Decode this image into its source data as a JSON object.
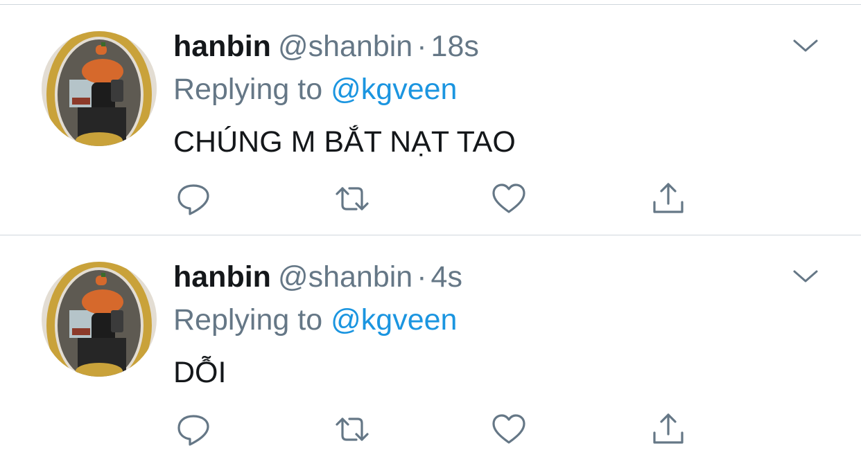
{
  "tweets": [
    {
      "display_name": "hanbin",
      "handle": "@shanbin",
      "separator": "·",
      "time": "18s",
      "replying_prefix": "Replying to",
      "replying_to": "@kgveen",
      "text": "CHÚNG M BẮT NẠT TAO"
    },
    {
      "display_name": "hanbin",
      "handle": "@shanbin",
      "separator": "·",
      "time": "4s",
      "replying_prefix": "Replying to",
      "replying_to": "@kgveen",
      "text": "DỖI"
    }
  ],
  "icons": {
    "menu": "chevron-down-icon",
    "reply": "reply-icon",
    "retweet": "retweet-icon",
    "like": "heart-icon",
    "share": "share-icon"
  },
  "colors": {
    "text_primary": "#14171a",
    "text_secondary": "#657786",
    "link": "#1b95e0",
    "icon": "#657786",
    "divider": "#cfd6dc"
  }
}
